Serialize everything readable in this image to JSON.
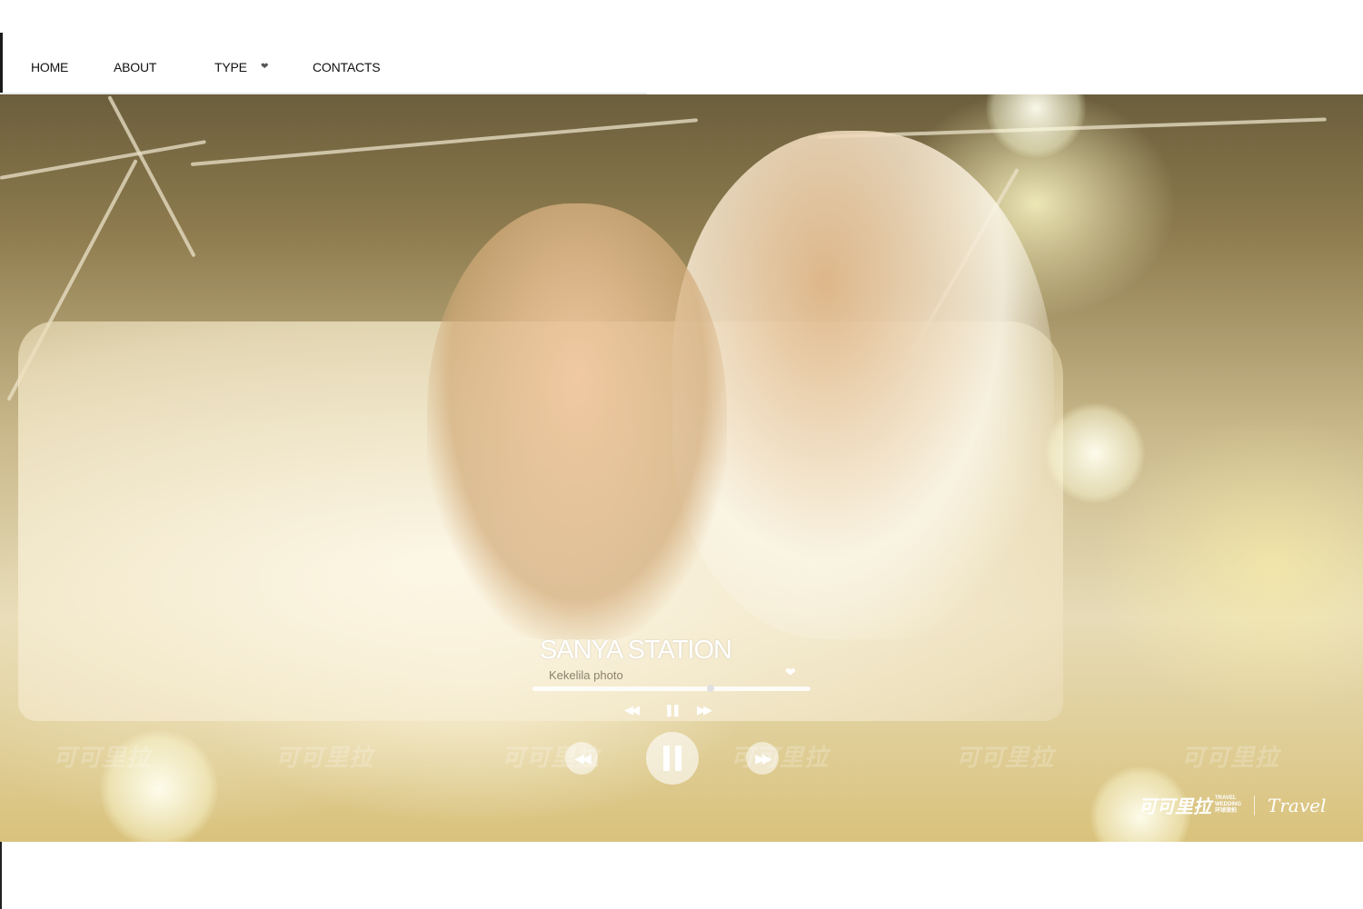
{
  "nav": {
    "items": [
      "HOME",
      "ABOUT",
      "TYPE",
      "CONTACTS"
    ],
    "type_dropdown_icon": "heart-chevron"
  },
  "player": {
    "title": "SANYA STATION",
    "subtitle": "Kekelila photo",
    "progress_fraction": 0.64,
    "small_controls": {
      "rewind": "◀◀",
      "pause": "❚❚",
      "forward": "▶▶"
    },
    "big_controls": {
      "prev": "◀◀",
      "next": "▶▶"
    },
    "favorite_icon": "heart-icon"
  },
  "watermark": {
    "text": "可可里拉"
  },
  "brand": {
    "cn_name": "可可里拉",
    "tagline_en_1": "TRAVEL",
    "tagline_en_2": "WEDDING",
    "tagline_cn": "环球旅拍",
    "travel_logo": "Travel"
  },
  "colors": {
    "overlay_gold": "#d9c27c",
    "white": "#ffffff"
  }
}
